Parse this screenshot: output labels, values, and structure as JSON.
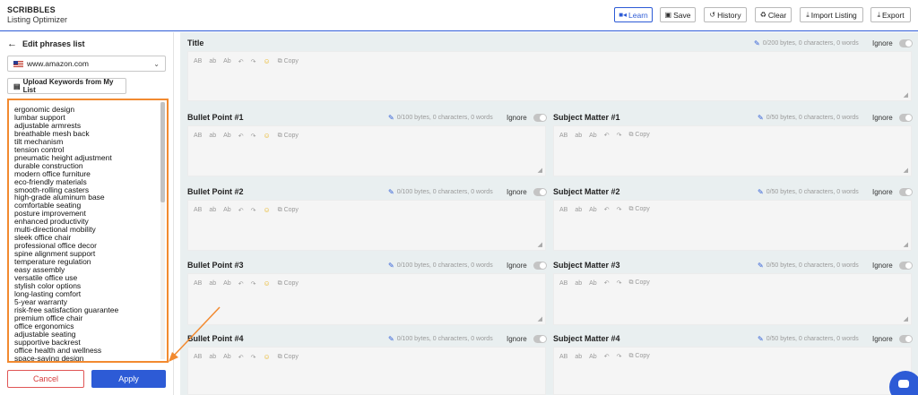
{
  "header": {
    "brand": "SCRIBBLES",
    "subtitle": "Listing Optimizer",
    "buttons": {
      "learn": "Learn",
      "save": "Save",
      "history": "History",
      "clear": "Clear",
      "import": "Import Listing",
      "export": "Export"
    }
  },
  "sidebar": {
    "back_label": "Edit phrases list",
    "domain": "www.amazon.com",
    "upload_label": "Upload Keywords from My List",
    "phrases": [
      "ergonomic design",
      "lumbar support",
      "adjustable armrests",
      "breathable mesh back",
      "tilt mechanism",
      "tension control",
      "pneumatic height adjustment",
      "durable construction",
      "modern office furniture",
      "eco-friendly materials",
      "smooth-rolling casters",
      "high-grade aluminum base",
      "comfortable seating",
      "posture improvement",
      "enhanced productivity",
      "multi-directional mobility",
      "sleek office chair",
      "professional office decor",
      "spine alignment support",
      "temperature regulation",
      "easy assembly",
      "versatile office use",
      "stylish color options",
      "long-lasting comfort",
      "5-year warranty",
      "risk-free satisfaction guarantee",
      "premium office chair",
      "office ergonomics",
      "adjustable seating",
      "supportive backrest",
      "office health and wellness",
      "space-saving design"
    ],
    "cancel_label": "Cancel",
    "apply_label": "Apply"
  },
  "editor_tools": {
    "uppercase": "AB",
    "lowercase": "ab",
    "capitalize": "Ab",
    "copy": "Copy"
  },
  "fields": {
    "ignore_label": "Ignore",
    "title": {
      "label": "Title",
      "meta": "0/200 bytes, 0 characters, 0 words"
    },
    "bullet1": {
      "label": "Bullet Point #1",
      "meta": "0/100 bytes, 0 characters, 0 words"
    },
    "bullet2": {
      "label": "Bullet Point #2",
      "meta": "0/100 bytes, 0 characters, 0 words"
    },
    "bullet3": {
      "label": "Bullet Point #3",
      "meta": "0/100 bytes, 0 characters, 0 words"
    },
    "bullet4": {
      "label": "Bullet Point #4",
      "meta": "0/100 bytes, 0 characters, 0 words"
    },
    "subject1": {
      "label": "Subject Matter #1",
      "meta": "0/50 bytes, 0 characters, 0 words"
    },
    "subject2": {
      "label": "Subject Matter #2",
      "meta": "0/50 bytes, 0 characters, 0 words"
    },
    "subject3": {
      "label": "Subject Matter #3",
      "meta": "0/50 bytes, 0 characters, 0 words"
    },
    "subject4": {
      "label": "Subject Matter #4",
      "meta": "0/50 bytes, 0 characters, 0 words"
    }
  },
  "colors": {
    "accent": "#2d5bd6",
    "annotation": "#f28a30",
    "cancel": "#d63a3a"
  }
}
